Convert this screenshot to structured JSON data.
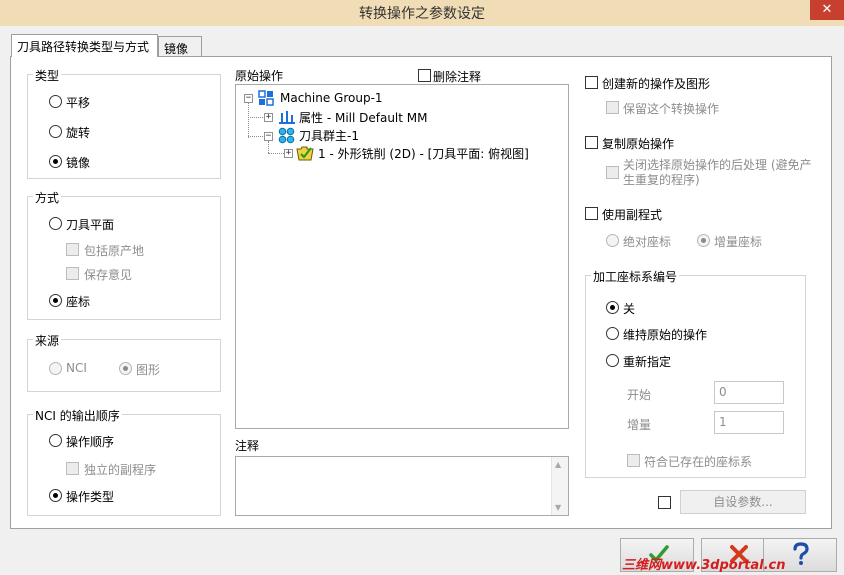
{
  "window": {
    "title": "转换操作之参数设定",
    "close_glyph": "✕"
  },
  "tabs": [
    {
      "label": "刀具路径转换类型与方式"
    },
    {
      "label": "镜像"
    }
  ],
  "type_group": {
    "label": "类型",
    "options": [
      "平移",
      "旋转",
      "镜像"
    ],
    "selected": "镜像"
  },
  "method_group": {
    "label": "方式",
    "tool_plane": "刀具平面",
    "include_origin": "包括原产地",
    "keep_intent": "保存意见",
    "coords": "座标",
    "selected": "座标"
  },
  "source_group": {
    "label": "来源",
    "nci": "NCI",
    "graphics": "图形",
    "selected": "图形"
  },
  "nci_order_group": {
    "label": "NCI 的输出顺序",
    "op_order": "操作顺序",
    "separate_sub": "独立的副程序",
    "op_type": "操作类型",
    "selected": "操作类型"
  },
  "original_ops": {
    "label": "原始操作",
    "delete_notes": "删除注释",
    "tree": {
      "root": "Machine Group-1",
      "props": "属性 - Mill Default MM",
      "group": "刀具群主-1",
      "op": "1 - 外形铣削 (2D) - [刀具平面: 俯视图]"
    }
  },
  "notes": {
    "label": "注释",
    "value": ""
  },
  "right_options": {
    "create_new": "创建新的操作及图形",
    "keep_transform": "保留这个转换操作",
    "copy_original": "复制原始操作",
    "disable_post": "关闭选择原始操作的后处理 (避免产生重复的程序)",
    "use_subprogram": "使用副程式",
    "absolute": "绝对座标",
    "incremental": "增量座标",
    "sub_selected": "增量座标"
  },
  "wcs_group": {
    "label": "加工座标系编号",
    "off": "关",
    "keep_original": "维持原始的操作",
    "reassign": "重新指定",
    "selected": "关",
    "start_label": "开始",
    "start_value": "0",
    "increment_label": "增量",
    "increment_value": "1",
    "match_existing": "符合已存在的座标系"
  },
  "custom_params": {
    "label": "自设参数..."
  },
  "bottom_buttons": {
    "ok": "ok-icon",
    "cancel": "cancel-icon",
    "help": "help-icon"
  },
  "watermark": "三维网www.3dportal.cn",
  "colors": {
    "titlebar": "#f0ddb5",
    "close": "#c7402f",
    "accent_blue": "#1e6fd9",
    "ok_green": "#2e9c2e",
    "cancel_red": "#d43a1e"
  }
}
